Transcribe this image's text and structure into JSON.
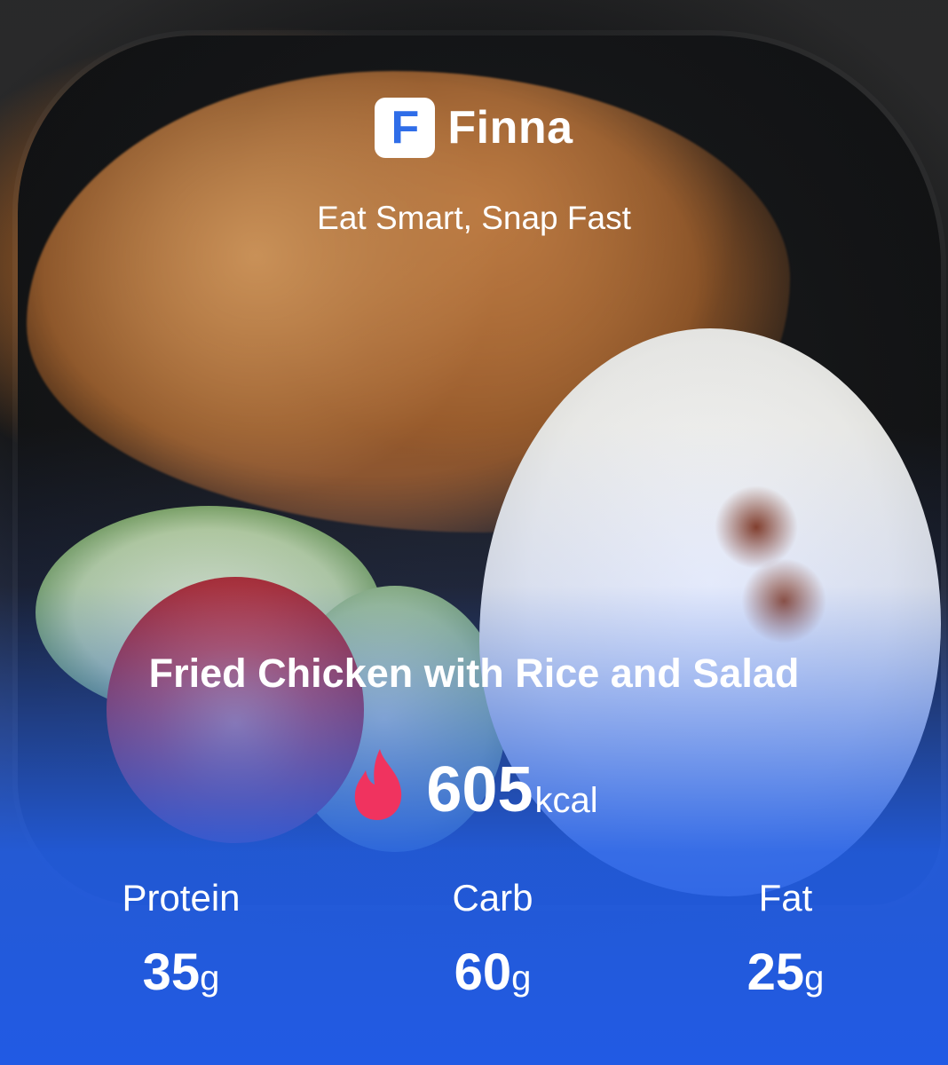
{
  "brand": {
    "logo_letter": "F",
    "name": "Finna",
    "tagline": "Eat Smart, Snap Fast"
  },
  "meal": {
    "name": "Fried Chicken with Rice and Salad",
    "calories_value": "605",
    "calories_unit": "kcal"
  },
  "macros": [
    {
      "label": "Protein",
      "value": "35",
      "unit": "g"
    },
    {
      "label": "Carb",
      "value": "60",
      "unit": "g"
    },
    {
      "label": "Fat",
      "value": "25",
      "unit": "g"
    }
  ],
  "icons": {
    "calorie_icon": "flame-icon",
    "logo_icon": "finna-logo-icon"
  },
  "colors": {
    "accent_blue": "#2f6de8",
    "flame_pink": "#f0335f",
    "text": "#ffffff"
  }
}
